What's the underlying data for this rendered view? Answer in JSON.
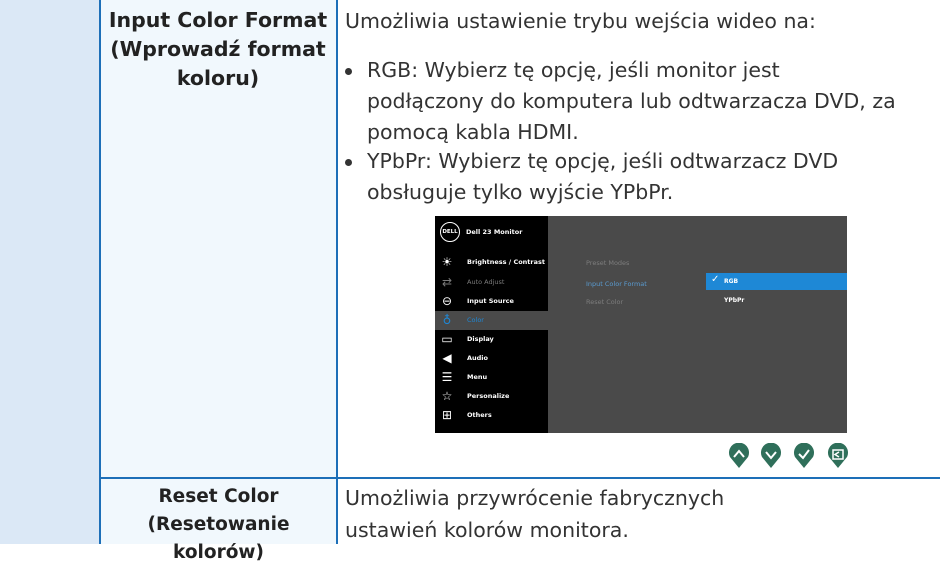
{
  "rows": [
    {
      "setting_name": "Input Color Format",
      "setting_name_pl": "(Wprowadź format koloru)",
      "description": "Umożliwia ustawienie trybu wejścia wideo na:",
      "bullets": [
        "RGB: Wybierz tę opcję, jeśli monitor jest podłączony do komputera lub odtwarzacza DVD, za pomocą kabla HDMI.",
        "YPbPr: Wybierz tę opcję, jeśli odtwarzacz DVD obsługuje tylko wyjście YPbPr."
      ]
    },
    {
      "setting_name": "Reset Color",
      "setting_name_pl": "(Resetowanie kolorów)",
      "description": "Umożliwia przywrócenie fabrycznych ustawień kolorów monitora."
    }
  ],
  "osd": {
    "logo": "DELL",
    "title": "Dell 23 Monitor",
    "menu": [
      {
        "label": "Brightness / Contrast",
        "icon": "brightness-icon",
        "state": "normal"
      },
      {
        "label": "Auto Adjust",
        "icon": "auto-adjust-icon",
        "state": "dim"
      },
      {
        "label": "Input Source",
        "icon": "input-source-icon",
        "state": "normal"
      },
      {
        "label": "Color",
        "icon": "color-icon",
        "state": "selected"
      },
      {
        "label": "Display",
        "icon": "display-icon",
        "state": "normal"
      },
      {
        "label": "Audio",
        "icon": "audio-icon",
        "state": "normal"
      },
      {
        "label": "Menu",
        "icon": "menu-icon",
        "state": "normal"
      },
      {
        "label": "Personalize",
        "icon": "personalize-icon",
        "state": "normal"
      },
      {
        "label": "Others",
        "icon": "others-icon",
        "state": "normal"
      }
    ],
    "submenu": [
      "Preset Modes",
      "Input Color Format",
      "Reset Color"
    ],
    "submenu_selected": "Input Color Format",
    "options": [
      "RGB",
      "YPbPr"
    ],
    "selected_option": "RGB",
    "nav_buttons": [
      "up-button-icon",
      "down-button-icon",
      "ok-button-icon",
      "back-button-icon"
    ]
  },
  "colors": {
    "border": "#1d6fb8",
    "accent": "#1e88d6",
    "osd_bg": "#4a4a4a",
    "nav_green": "#2f6f5a"
  }
}
